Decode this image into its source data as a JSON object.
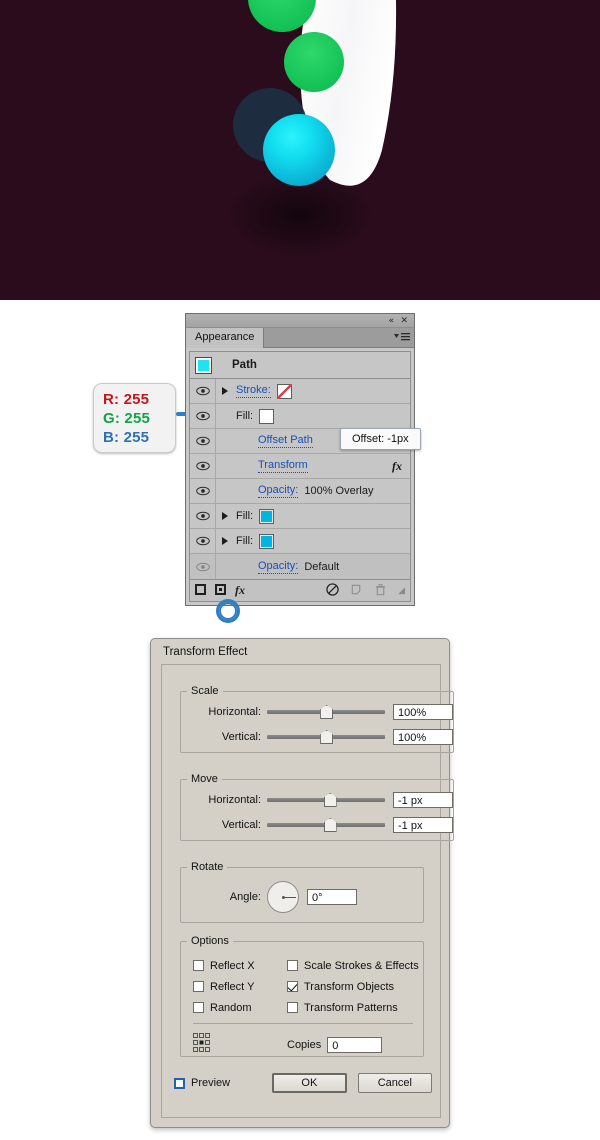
{
  "artwork": {
    "background_color": "#2a0c1c",
    "shapes": [
      {
        "name": "white-crescent",
        "color": "#fbfbfb"
      },
      {
        "name": "green-circle-top",
        "color": "#18c55a"
      },
      {
        "name": "green-circle-second",
        "color": "#18c55a"
      },
      {
        "name": "dark-blue-circle",
        "color": "#1f3347"
      },
      {
        "name": "cyan-circle",
        "color": "#0fb3d8"
      },
      {
        "name": "cyan-highlight",
        "color": "#12e9f4"
      }
    ]
  },
  "rgb_callout": {
    "r": "R: 255",
    "g": "G: 255",
    "b": "B: 255",
    "r_color": "#c4161c",
    "g_color": "#12a347",
    "b_color": "#2f6fb8"
  },
  "appearance_panel": {
    "titlebar": {
      "collapse_icon": "«",
      "close_icon": "✕"
    },
    "tab_label": "Appearance",
    "menu_icon": "panel-menu-icon",
    "header": {
      "title": "Path",
      "swatch_color": "#1fe3ef"
    },
    "rows": [
      {
        "label": "Stroke:",
        "link": true,
        "value": "",
        "eye": true,
        "triangle": true,
        "swatch": "none"
      },
      {
        "label": "Fill:",
        "link": false,
        "value": "",
        "eye": true,
        "triangle": false,
        "swatch": "white"
      },
      {
        "label": "Offset Path",
        "link": true,
        "value": "",
        "eye": true,
        "triangle": false,
        "swatch": null
      },
      {
        "label": "Transform",
        "link": true,
        "value": "",
        "eye": true,
        "triangle": false,
        "swatch": null,
        "fx": "fx"
      },
      {
        "label": "Opacity:",
        "link": true,
        "value": "100% Overlay",
        "eye": true,
        "triangle": false,
        "swatch": null
      },
      {
        "label": "Fill:",
        "link": false,
        "value": "",
        "eye": true,
        "triangle": true,
        "swatch": "cyan"
      },
      {
        "label": "Fill:",
        "link": false,
        "value": "",
        "eye": true,
        "triangle": true,
        "swatch": "cyan"
      },
      {
        "label": "Opacity:",
        "link": true,
        "value": "Default",
        "eye": false,
        "triangle": false,
        "swatch": null
      }
    ],
    "footer": {
      "new_stroke": "add-new-stroke-icon",
      "new_fill": "add-new-fill-icon",
      "fx_label": "fx",
      "clear_appearance": "clear-appearance-icon",
      "duplicate": "duplicate-item-icon",
      "delete": "delete-item-icon"
    }
  },
  "tooltip": {
    "text": "Offset: -1px"
  },
  "transform_dialog": {
    "title": "Transform Effect",
    "scale": {
      "legend": "Scale",
      "horizontal_label": "Horizontal:",
      "horizontal_value": "100%",
      "horizontal_slider_pct": 45,
      "vertical_label": "Vertical:",
      "vertical_value": "100%",
      "vertical_slider_pct": 45
    },
    "move": {
      "legend": "Move",
      "horizontal_label": "Horizontal:",
      "horizontal_value": "-1 px",
      "horizontal_slider_pct": 48,
      "vertical_label": "Vertical:",
      "vertical_value": "-1 px",
      "vertical_slider_pct": 48
    },
    "rotate": {
      "legend": "Rotate",
      "angle_label": "Angle:",
      "angle_value": "0°",
      "angle_degrees": 0
    },
    "options": {
      "legend": "Options",
      "items": [
        {
          "label": "Reflect X",
          "checked": false
        },
        {
          "label": "Reflect Y",
          "checked": false
        },
        {
          "label": "Random",
          "checked": false
        },
        {
          "label": "Scale Strokes & Effects",
          "checked": false
        },
        {
          "label": "Transform Objects",
          "checked": true
        },
        {
          "label": "Transform Patterns",
          "checked": false
        }
      ],
      "copies_label": "Copies",
      "copies_value": "0",
      "anchor_icon": "reference-point-grid-icon"
    },
    "footer": {
      "preview_label": "Preview",
      "preview_checked": false,
      "ok_label": "OK",
      "cancel_label": "Cancel"
    }
  }
}
